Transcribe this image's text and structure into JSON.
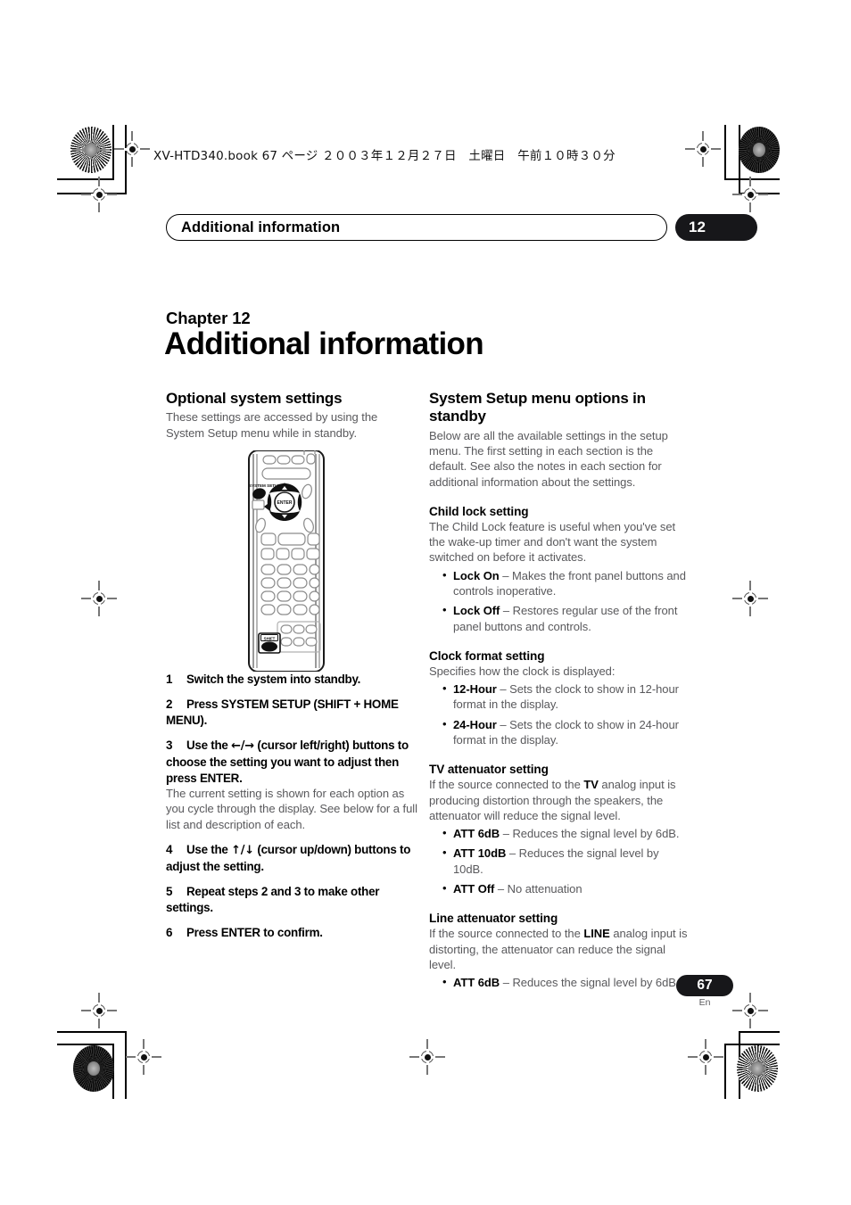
{
  "page": {
    "book_line": "XV-HTD340.book  67 ページ  ２００３年１２月２７日　土曜日　午前１０時３０分",
    "running_head": "Additional information",
    "chapter_badge": "12",
    "page_number": "67",
    "page_language": "En",
    "accent_color": "#17171a",
    "body_text_color": "#59595c"
  },
  "chapter": {
    "eyebrow": "Chapter 12",
    "title": "Additional information"
  },
  "left_column": {
    "heading": "Optional system settings",
    "intro": "These settings are accessed by using the System Setup menu while in standby.",
    "remote": {
      "caption_labels": {
        "system_setup": "SYSTEM SETUP",
        "enter": "ENTER",
        "shift": "SHIFT"
      }
    },
    "steps": [
      {
        "num": "1",
        "text": "Switch the system into standby.",
        "note": ""
      },
      {
        "num": "2",
        "text": "Press SYSTEM SETUP (SHIFT + HOME MENU).",
        "note": ""
      },
      {
        "num": "3",
        "text_before": "Use the ",
        "arrows": "←/→",
        "text_after": " (cursor left/right) buttons to choose the setting you want to adjust then press ENTER.",
        "text": "Use the ←/→ (cursor left/right) buttons to choose the setting you want to adjust then press ENTER.",
        "note": "The current setting is shown for each option as you cycle through the display. See below for a full list and description of each."
      },
      {
        "num": "4",
        "text_before": "Use the ",
        "arrows": "↑/↓",
        "text_after": " (cursor up/down) buttons to adjust the setting.",
        "text": "Use the ↑/↓ (cursor up/down) buttons to adjust the setting.",
        "note": ""
      },
      {
        "num": "5",
        "text": "Repeat steps 2 and 3 to make other settings.",
        "note": ""
      },
      {
        "num": "6",
        "text": "Press ENTER to confirm.",
        "note": ""
      }
    ]
  },
  "right_column": {
    "heading": "System Setup menu options in standby",
    "intro": "Below are all the available settings in the setup menu. The first setting in each section is the default. See also the notes in each section for additional information about the settings.",
    "sections": [
      {
        "title": "Child lock setting",
        "intro": "The Child Lock feature is useful when you've set the wake-up timer and don't want the system switched on before it activates.",
        "bullets": [
          {
            "term": "Lock On",
            "dash": " – ",
            "desc": "Makes the front panel buttons and controls inoperative."
          },
          {
            "term": "Lock Off",
            "dash": " – ",
            "desc": "Restores regular use of the front panel buttons and controls."
          }
        ]
      },
      {
        "title": "Clock format setting",
        "intro": "Specifies how the clock is displayed:",
        "bullets": [
          {
            "term": "12-Hour",
            "dash": " – ",
            "desc": "Sets the clock to show in 12-hour format in the display."
          },
          {
            "term": "24-Hour",
            "dash": " – ",
            "desc": "Sets the clock to show in 24-hour format in the display."
          }
        ]
      },
      {
        "title": "TV attenuator setting",
        "intro_a": "If the source connected to the ",
        "intro_bold": "TV",
        "intro_b": " analog input is producing distortion through the speakers, the attenuator will reduce the signal level.",
        "bullets": [
          {
            "term": "ATT 6dB",
            "dash": " – ",
            "desc": "Reduces the signal level by 6dB."
          },
          {
            "term": "ATT 10dB",
            "dash": " – ",
            "desc": "Reduces the signal level by 10dB."
          },
          {
            "term": "ATT Off",
            "dash": " – ",
            "desc": "No attenuation"
          }
        ]
      },
      {
        "title": "Line attenuator setting",
        "intro_a": "If the source connected to the ",
        "intro_bold": "LINE",
        "intro_b": " analog input is distorting, the attenuator can reduce the signal level.",
        "bullets": [
          {
            "term": "ATT 6dB",
            "dash": " – ",
            "desc": "Reduces the signal level by 6dB."
          }
        ]
      }
    ]
  }
}
